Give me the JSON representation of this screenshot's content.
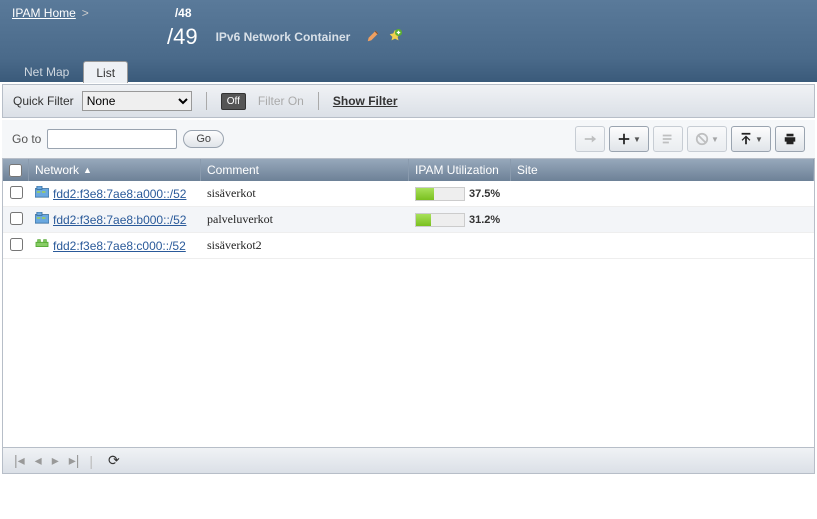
{
  "breadcrumb": {
    "home": "IPAM Home",
    "sep": ">",
    "path_end": "/48"
  },
  "header": {
    "title": "/49",
    "subtitle": "IPv6 Network Container"
  },
  "tabs": [
    {
      "label": "Net Map",
      "active": false
    },
    {
      "label": "List",
      "active": true
    }
  ],
  "filter": {
    "quick_label": "Quick Filter",
    "quick_value": "None",
    "off_label": "Off",
    "filter_on": "Filter On",
    "show_filter": "Show Filter"
  },
  "goto": {
    "label": "Go to",
    "value": "",
    "button": "Go"
  },
  "columns": {
    "network": "Network",
    "comment": "Comment",
    "util": "IPAM Utilization",
    "site": "Site"
  },
  "rows": [
    {
      "icon": "container",
      "network": "fdd2:f3e8:7ae8:a000::/52",
      "comment": "sisäverkot",
      "util_pct": 37.5,
      "util_label": "37.5%",
      "site": ""
    },
    {
      "icon": "container",
      "network": "fdd2:f3e8:7ae8:b000::/52",
      "comment": "palveluverkot",
      "util_pct": 31.2,
      "util_label": "31.2%",
      "site": ""
    },
    {
      "icon": "network",
      "network": "fdd2:f3e8:7ae8:c000::/52",
      "comment": "sisäverkot2",
      "util_pct": null,
      "util_label": "",
      "site": ""
    }
  ]
}
